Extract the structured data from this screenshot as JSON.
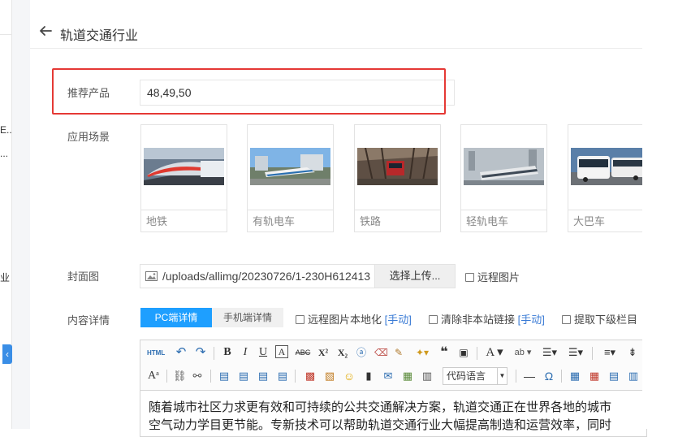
{
  "header": {
    "title": "轨道交通行业"
  },
  "fields": {
    "recommended": {
      "label": "推荐产品",
      "value": "48,49,50"
    },
    "scenes": {
      "label": "应用场景",
      "items": [
        {
          "caption": "地铁",
          "icon": "subway-photo"
        },
        {
          "caption": "有轨电车",
          "icon": "tram-photo"
        },
        {
          "caption": "铁路",
          "icon": "railway-photo"
        },
        {
          "caption": "轻轨电车",
          "icon": "light-rail-photo"
        },
        {
          "caption": "大巴车",
          "icon": "bus-photo"
        }
      ]
    },
    "cover": {
      "label": "封面图",
      "path": "/uploads/allimg/20230726/1-230H612413",
      "upload_label": "选择上传...",
      "remote_label": "远程图片"
    },
    "content": {
      "label": "内容详情",
      "tab_pc": "PC端详情",
      "tab_mobile": "手机端详情",
      "opt_localize": "远程图片本地化",
      "opt_localize_link": "[手动]",
      "opt_clear_links": "清除非本站链接",
      "opt_clear_links_link": "[手动]",
      "opt_fetch_lower": "提取下级栏目",
      "code_lang_placeholder": "代码语言",
      "body_line1": "随着城市社区力求更有效和可持续的公共交通解决方案，轨道交通正在世界各地的城市",
      "body_line2": "空气动力学目更节能。专新技术可以帮助轨道交通行业大幅提高制造和运营效率，同时"
    }
  },
  "sidebar_fragments": [
    "E...",
    "...",
    "业"
  ],
  "colors": {
    "primary": "#1e9fff",
    "highlight_box": "#e53935",
    "link": "#3a7bd5"
  }
}
